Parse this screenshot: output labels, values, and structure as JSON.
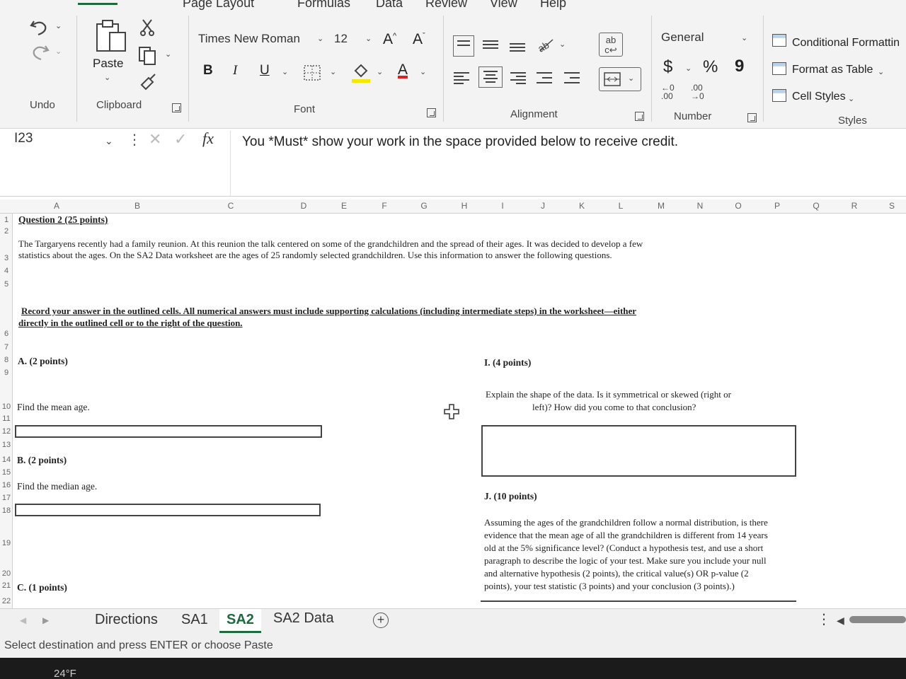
{
  "ribbon": {
    "tabs": [
      "Page Layout",
      "Formulas",
      "Data",
      "Review",
      "View",
      "Help"
    ],
    "undo_label": "Undo",
    "paste_label": "Paste",
    "clipboard_label": "Clipboard",
    "font_name": "Times New Roman",
    "font_size": "12",
    "font_label": "Font",
    "bold": "B",
    "italic": "I",
    "underline": "U",
    "font_color_glyph": "A",
    "alignment_label": "Alignment",
    "number_format": "General",
    "currency": "$",
    "percent": "%",
    "comma": "9",
    "number_label": "Number",
    "conditional_formatting": "Conditional Formattin",
    "format_as_table": "Format as Table",
    "cell_styles": "Cell Styles",
    "styles_label": "Styles"
  },
  "formula_bar": {
    "name_box": "I23",
    "fx": "fx",
    "content": "You *Must* show your work in the space provided below to receive credit."
  },
  "grid": {
    "columns": [
      "A",
      "B",
      "C",
      "D",
      "E",
      "F",
      "G",
      "H",
      "I",
      "J",
      "K",
      "L",
      "M",
      "N",
      "O",
      "P",
      "Q",
      "R",
      "S"
    ],
    "rows": [
      "1",
      "2",
      "3",
      "4",
      "5",
      "6",
      "7",
      "8",
      "9",
      "10",
      "11",
      "12",
      "13",
      "14",
      "15",
      "16",
      "17",
      "18",
      "19",
      "20",
      "21",
      "22"
    ]
  },
  "sheet": {
    "question_title": "Question 2 (25 points)",
    "intro_line1": "The Targaryens recently had a family reunion.  At this reunion the talk centered on some of the grandchildren and the spread of their ages.  It was decided to develop a few",
    "intro_line2": "statistics about the ages.  On the SA2 Data worksheet are the ages of 25 randomly selected grandchildren.  Use this information to answer the following questions.",
    "record_line1": "Record your answer in the outlined cells.  All numerical answers must include supporting calculations (including intermediate steps)  in the worksheet—either",
    "record_line2": "directly in the outlined cell or to the right of the question.",
    "a_title": "A. (2 points)",
    "a_text": "Find the mean age.",
    "b_title": "B. (2 points)",
    "b_text": "Find the median age.",
    "c_title": "C. (1 points)",
    "i_title": "I. (4 points)",
    "i_line1": "Explain the shape of the data.  Is it symmetrical or skewed (right or",
    "i_line2": "left)? How did you come to that conclusion?",
    "j_title": "J. (10 points)",
    "j_lines": [
      "Assuming the ages of the grandchildren follow a normal distribution, is there",
      "evidence that the mean age of all the grandchildren is different from 14 years",
      "old at the 5% significance level? (Conduct a hypothesis test, and use a short",
      "paragraph to describe the logic of your test.  Make sure you include your null",
      "and alternative hypothesis (2 points), the critical value(s) OR p-value (2",
      "points), your test statistic (3 points) and your conclusion (3 points).)"
    ]
  },
  "sheet_tabs": [
    "Directions",
    "SA1",
    "SA2",
    "SA2 Data"
  ],
  "active_sheet": "SA2",
  "status": "Select destination and press ENTER or choose Paste",
  "weather": "24°F",
  "colors": {
    "accent_green": "#1d6b3c",
    "ribbon_bg": "#f3f3f3"
  }
}
